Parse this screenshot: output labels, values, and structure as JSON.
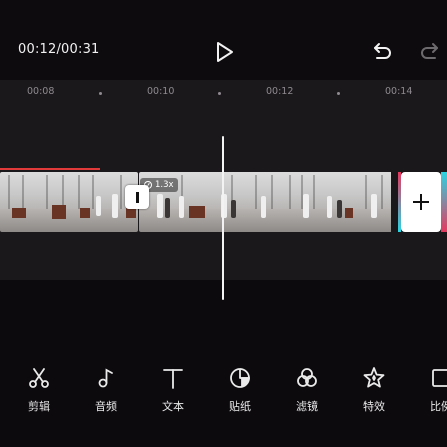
{
  "header": {
    "time_readout": "00:12/00:31"
  },
  "icons": {
    "play": "play-icon",
    "undo": "undo-icon",
    "redo": "redo-icon"
  },
  "ruler": {
    "labels": [
      "00:08",
      "00:10",
      "00:12",
      "00:14"
    ]
  },
  "timeline": {
    "speed_badge": "1.3x",
    "transition_marker": "transition-icon",
    "add_clip": "plus-icon"
  },
  "toolbar": {
    "items": [
      {
        "label": "剪辑",
        "icon": "scissors-icon"
      },
      {
        "label": "音频",
        "icon": "music-note-icon"
      },
      {
        "label": "文本",
        "icon": "text-icon"
      },
      {
        "label": "贴纸",
        "icon": "sticker-icon"
      },
      {
        "label": "滤镜",
        "icon": "filter-icon"
      },
      {
        "label": "特效",
        "icon": "effects-star-icon"
      },
      {
        "label": "比例",
        "icon": "ratio-icon"
      }
    ]
  },
  "colors": {
    "background": "#0d0a0e",
    "timeline_bg": "#1b181c",
    "accent_red": "#e2393b",
    "accent_cyan": "#2bd4e2",
    "accent_pink": "#e5395f"
  }
}
